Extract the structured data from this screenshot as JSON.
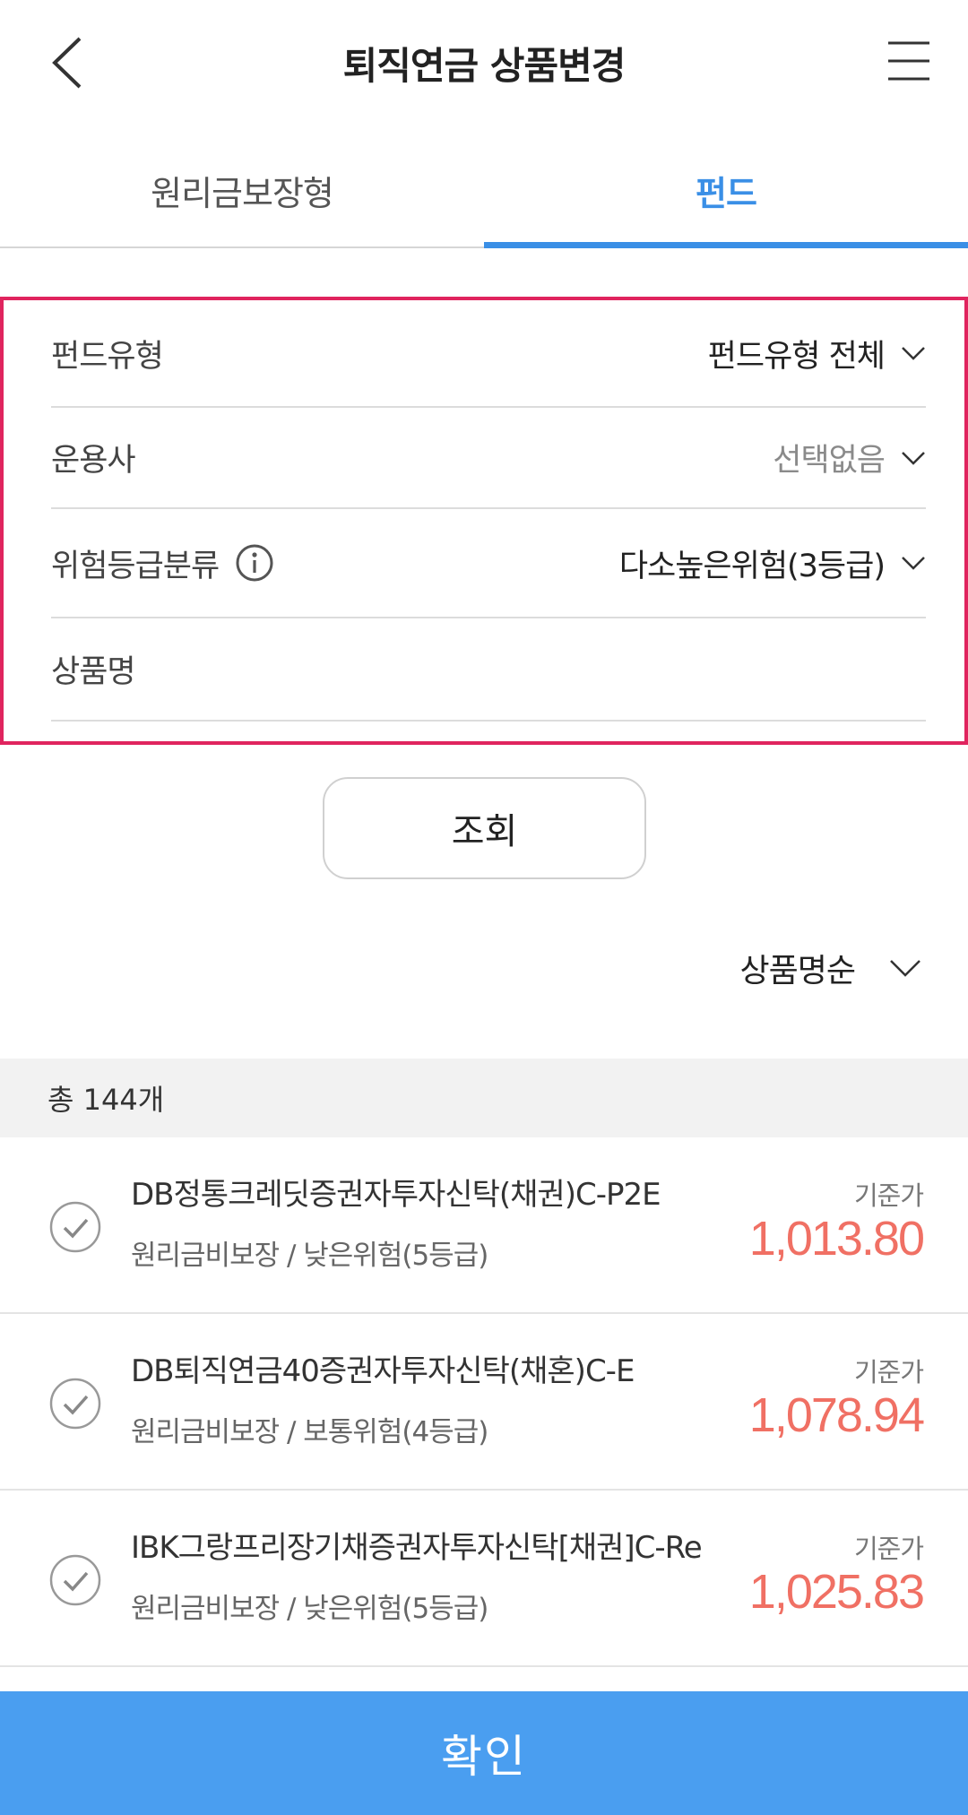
{
  "header": {
    "title": "퇴직연금 상품변경",
    "back_icon": "chevron-left-icon",
    "menu_icon": "hamburger-menu-icon"
  },
  "tabs": [
    {
      "label": "원리금보장형",
      "active": false
    },
    {
      "label": "펀드",
      "active": true
    }
  ],
  "filters": {
    "fund_type": {
      "label": "펀드유형",
      "value": "펀드유형 전체"
    },
    "manager": {
      "label": "운용사",
      "value": "선택없음"
    },
    "risk_grade": {
      "label": "위험등급분류",
      "value": "다소높은위험(3등급)"
    },
    "product_name": {
      "label": "상품명",
      "value": ""
    }
  },
  "search_button": "조회",
  "sort": {
    "value": "상품명순"
  },
  "count_text": "총 144개",
  "items": [
    {
      "name": "DB정통크레딧증권자투자신탁(채권)C-P2E",
      "sub": "원리금비보장 / 낮은위험(5등급)",
      "price_label": "기준가",
      "price": "1,013.80"
    },
    {
      "name": "DB퇴직연금40증권자투자신탁(채혼)C-E",
      "sub": "원리금비보장 / 보통위험(4등급)",
      "price_label": "기준가",
      "price": "1,078.94"
    },
    {
      "name": "IBK그랑프리장기채증권자투자신탁[채권]C-Re",
      "sub": "원리금비보장 / 낮은위험(5등급)",
      "price_label": "기준가",
      "price": "1,025.83"
    }
  ],
  "confirm_button": "확인",
  "colors": {
    "accent_blue": "#3a8fe6",
    "confirm_bg": "#4a9ef0",
    "highlight_border": "#e0245e",
    "price_red": "#f07064"
  }
}
